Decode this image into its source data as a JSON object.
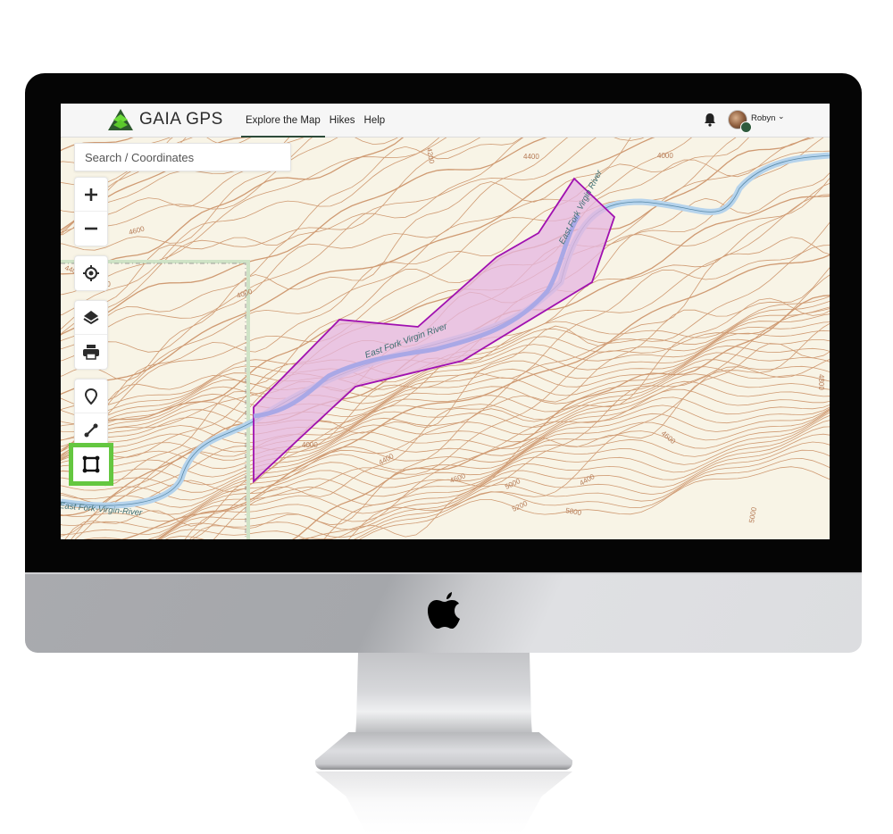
{
  "app": {
    "brand": "GAIA GPS",
    "brand_color": "#3a7d3a",
    "nav": [
      {
        "label": "Explore the Map",
        "active": true
      },
      {
        "label": "Hikes",
        "active": false
      },
      {
        "label": "Help",
        "active": false
      }
    ],
    "user": {
      "name": "Robyn",
      "menu_icon": "chevron-down-icon"
    },
    "notifications_icon": "bell-icon"
  },
  "search": {
    "placeholder": "Search / Coordinates"
  },
  "map_controls": [
    {
      "name": "zoom-in",
      "icon": "plus-icon"
    },
    {
      "name": "zoom-out",
      "icon": "minus-icon"
    },
    {
      "name": "locate",
      "icon": "crosshair-icon"
    },
    {
      "name": "layers",
      "icon": "layers-icon"
    },
    {
      "name": "print",
      "icon": "printer-icon"
    },
    {
      "name": "add-waypoint",
      "icon": "map-pin-icon"
    },
    {
      "name": "draw-route",
      "icon": "route-icon"
    },
    {
      "name": "draw-area",
      "icon": "polygon-icon",
      "highlighted": true,
      "highlight_color": "#64c740"
    }
  ],
  "map": {
    "river_labels": [
      "East Fork Virgin River",
      "East Fork Virgin River",
      "East Fork-Virgin-River"
    ],
    "contour_labels": [
      "4400",
      "4200",
      "4600",
      "4000",
      "4200",
      "4400",
      "4000",
      "4000",
      "4400",
      "4600",
      "4800",
      "4600",
      "5000",
      "5200",
      "5800",
      "5000",
      "4400"
    ],
    "area_fill_color": "#e6b6e0",
    "area_stroke_color": "#a010b0",
    "river_color": "#b5d3ec",
    "contour_color": "#c98a5e"
  }
}
